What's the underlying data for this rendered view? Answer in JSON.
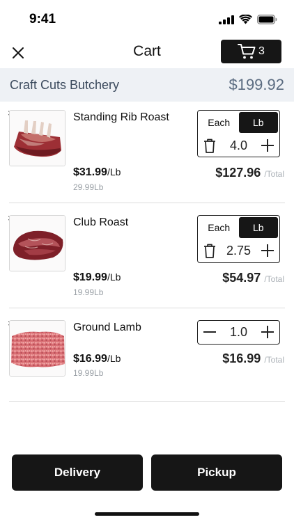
{
  "status_bar": {
    "time": "9:41"
  },
  "nav": {
    "title": "Cart",
    "cart_count": "3"
  },
  "store": {
    "name": "Craft Cuts Butchery",
    "total": "$199.92"
  },
  "unit_toggle": {
    "each_label": "Each",
    "lb_label": "Lb"
  },
  "items": [
    {
      "remove": "×",
      "name": "Standing Rib Roast",
      "price": "$31.99",
      "price_unit": "/Lb",
      "base_price": "29.99Lb",
      "quantity": "4.0",
      "total": "$127.96",
      "total_suffix": "/Total",
      "selected_unit": "Lb"
    },
    {
      "remove": "×",
      "name": "Club Roast",
      "price": "$19.99",
      "price_unit": "/Lb",
      "base_price": "19.99Lb",
      "quantity": "2.75",
      "total": "$54.97",
      "total_suffix": "/Total",
      "selected_unit": "Lb"
    },
    {
      "remove": "×",
      "name": "Ground Lamb",
      "price": "$16.99",
      "price_unit": "/Lb",
      "base_price": "19.99Lb",
      "quantity": "1.0",
      "total": "$16.99",
      "total_suffix": "/Total"
    }
  ],
  "footer": {
    "delivery_label": "Delivery",
    "pickup_label": "Pickup"
  },
  "colors": {
    "primary": "#161616",
    "store_bar_bg": "#eef1f5",
    "store_text": "#3b4a5d",
    "muted_text": "#9aa0a6"
  }
}
